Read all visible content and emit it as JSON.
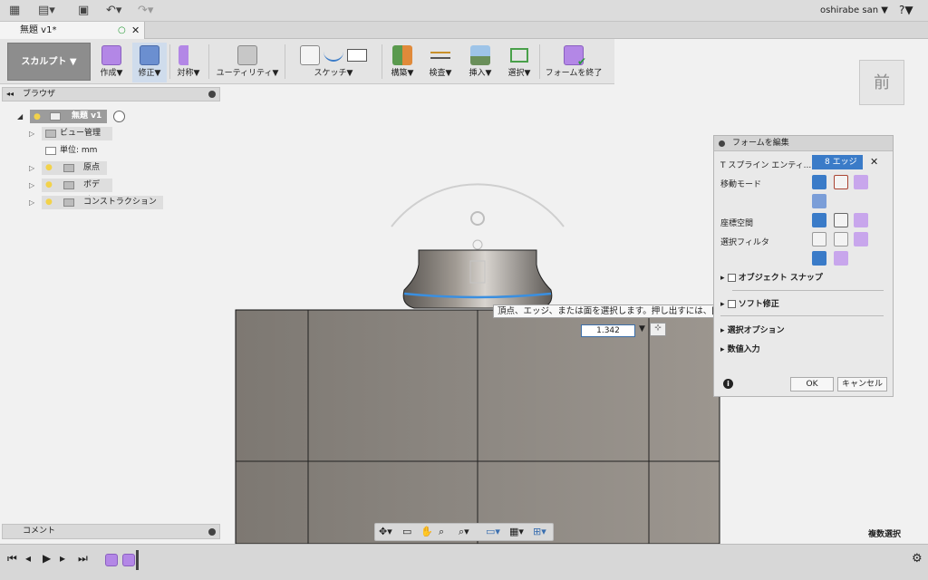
{
  "topbar": {
    "user": "oshirabe san ▼",
    "help": "?▼"
  },
  "doc_tab": {
    "title": "無題 v1*"
  },
  "ribbon": {
    "mode": "スカルプト ▼",
    "groups": [
      "作成▼",
      "修正▼",
      "対称▼",
      "ユーティリティ▼",
      "スケッチ▼",
      "構築▼",
      "検査▼",
      "挿入▼",
      "選択▼",
      "フォームを終了"
    ]
  },
  "browser": {
    "title": "ブラウザ",
    "root": "無題 v1",
    "items": [
      "ビュー管理",
      "単位: mm",
      "原点",
      "ボディ",
      "コンストラクション"
    ]
  },
  "comment": {
    "title": "コメント"
  },
  "panel": {
    "title": "フォームを編集",
    "tspline_label": "T スプライン エンティ...",
    "selection_badge": "8 エッジ",
    "move_mode": "移動モード",
    "coord_space": "座標空間",
    "select_filter": "選択フィルタ",
    "object_snap": "オブジェクト スナップ",
    "soft_modify": "ソフト修正",
    "select_options": "選択オプション",
    "numeric_input": "数値入力",
    "ok": "OK",
    "cancel": "キャンセル"
  },
  "tooltip": "頂点、エッジ、または面を選択します。押し出すには、[Alt]キーを押します",
  "input_value": "1.342",
  "viewcube": "前",
  "status_right": "複数選択",
  "colors": {
    "accent": "#3a7bc8",
    "body": "#8a857f",
    "sculpt": "#b387e6"
  }
}
